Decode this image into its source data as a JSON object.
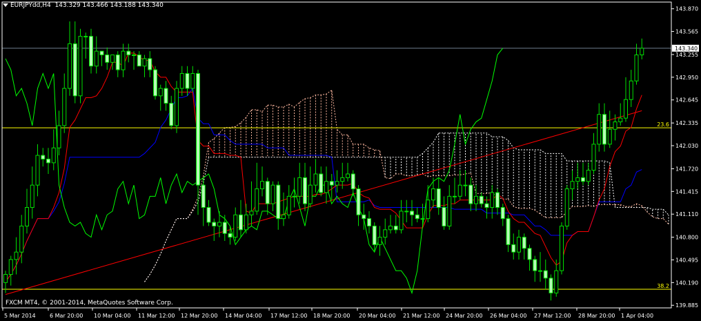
{
  "header": {
    "symbol_timeframe": "EURJPYdd,H4",
    "ohlc": "143.329 143.466 143.188 143.340"
  },
  "copyright": "FXCM MT4, © 2001-2014, MetaQuotes Software Corp.",
  "colors": {
    "background": "#000000",
    "axis": "#ffffff",
    "candle_body": "#b4ffb4",
    "candle_wick": "#00e000",
    "tenkan": "#ff0000",
    "kijun": "#0000ff",
    "chikou": "#00ff00",
    "cloud_a": "#ffb8a0",
    "cloud_b": "#ffffff",
    "fib": "#ffff00",
    "trendline": "#ff0000",
    "current_price_line": "#708090"
  },
  "chart_data": {
    "type": "candlestick",
    "y_ticks": [
      139.885,
      140.19,
      140.495,
      140.8,
      141.11,
      141.415,
      141.72,
      142.03,
      142.335,
      142.645,
      142.95,
      143.255,
      143.565,
      143.87
    ],
    "ylim": [
      139.85,
      143.96
    ],
    "x_ticks": [
      "5 Mar 2014",
      "6 Mar 20:00",
      "10 Mar 04:00",
      "11 Mar 12:00",
      "12 Mar 20:00",
      "14 Mar 04:00",
      "17 Mar 12:00",
      "18 Mar 20:00",
      "20 Mar 04:00",
      "21 Mar 12:00",
      "24 Mar 20:00",
      "26 Mar 04:00",
      "27 Mar 12:00",
      "28 Mar 20:00",
      "1 Apr 04:00"
    ],
    "current_price": {
      "label": "143.340",
      "value": 143.34
    },
    "fib_levels": [
      {
        "label": "23.6",
        "value": 142.27
      },
      {
        "label": "38.2",
        "value": 140.1
      }
    ],
    "trendline": {
      "start": {
        "bar": 0,
        "price": 140.03
      },
      "end": {
        "bar": 119,
        "price": 142.5
      }
    },
    "series": {
      "open": [
        140.19,
        140.3,
        140.5,
        140.6,
        140.95,
        141.2,
        141.5,
        141.9,
        141.85,
        141.8,
        142.0,
        142.3,
        142.8,
        143.4,
        142.7,
        143.5,
        143.5,
        143.1,
        143.3,
        143.25,
        143.15,
        143.25,
        143.05,
        143.3,
        143.25,
        143.25,
        143.1,
        143.2,
        143.05,
        142.7,
        142.8,
        142.6,
        142.3,
        142.8,
        143.0,
        142.8,
        143.0,
        141.5,
        141.2,
        141.0,
        140.95,
        141.0,
        140.85,
        140.8,
        141.1,
        140.9,
        141.1,
        141.15,
        141.45,
        141.55,
        141.25,
        141.5,
        141.05,
        141.1,
        141.35,
        141.35,
        141.6,
        141.25,
        141.5,
        141.65,
        141.4,
        141.55,
        141.5,
        141.55,
        141.6,
        141.65,
        141.45,
        141.1,
        141.05,
        140.95,
        140.7,
        140.8,
        140.9,
        140.95,
        140.9,
        141.15,
        141.15,
        141.1,
        141.05,
        141.05,
        141.3,
        141.45,
        141.2,
        140.95,
        141.35,
        141.35,
        141.5,
        141.5,
        141.25,
        141.35,
        141.25,
        141.2,
        141.4,
        141.2,
        141.05,
        140.7,
        140.6,
        140.8,
        140.65,
        140.5,
        140.35,
        140.35,
        140.25,
        140.05,
        140.35,
        140.95,
        141.45,
        141.55,
        141.6,
        141.55,
        141.7,
        142.05,
        142.45,
        142.05,
        142.25,
        142.35,
        142.4,
        142.65,
        142.9,
        143.25
      ],
      "high": [
        140.35,
        140.55,
        140.8,
        141.1,
        141.45,
        141.75,
        142.05,
        142.0,
        142.0,
        142.25,
        142.5,
        143.0,
        143.7,
        143.7,
        143.6,
        143.55,
        143.6,
        143.5,
        143.3,
        143.35,
        143.25,
        143.3,
        143.4,
        143.4,
        143.3,
        143.3,
        143.25,
        143.3,
        143.1,
        142.85,
        142.9,
        142.7,
        142.9,
        143.1,
        143.1,
        143.1,
        143.05,
        141.6,
        141.3,
        141.05,
        141.15,
        141.1,
        140.95,
        141.2,
        141.3,
        141.25,
        141.55,
        141.8,
        141.75,
        141.6,
        141.55,
        141.55,
        141.4,
        141.5,
        141.6,
        141.8,
        141.8,
        141.75,
        141.85,
        141.75,
        141.75,
        141.65,
        141.7,
        141.8,
        141.8,
        141.7,
        141.5,
        141.25,
        141.15,
        141.0,
        140.95,
        141.05,
        141.1,
        141.1,
        141.3,
        141.3,
        141.3,
        141.2,
        141.25,
        141.5,
        141.6,
        141.6,
        141.35,
        141.5,
        141.6,
        141.7,
        141.7,
        141.6,
        141.5,
        141.4,
        141.35,
        141.5,
        141.45,
        141.25,
        141.1,
        140.85,
        140.9,
        140.85,
        140.7,
        140.55,
        140.6,
        140.5,
        140.3,
        140.5,
        141.0,
        141.5,
        141.7,
        141.8,
        141.8,
        141.8,
        142.2,
        142.6,
        142.6,
        142.5,
        142.45,
        142.6,
        142.95,
        143.05,
        143.4,
        143.47
      ],
      "low": [
        140.05,
        140.15,
        140.3,
        140.45,
        140.85,
        141.05,
        141.35,
        141.75,
        141.65,
        141.7,
        141.9,
        142.2,
        142.7,
        142.6,
        142.6,
        143.2,
        143.0,
        143.0,
        143.1,
        143.05,
        143.05,
        142.95,
        142.95,
        143.15,
        143.05,
        143.1,
        142.95,
        142.95,
        142.65,
        142.5,
        142.5,
        142.25,
        142.2,
        142.7,
        142.7,
        142.75,
        141.1,
        140.95,
        140.95,
        140.75,
        140.8,
        140.75,
        140.7,
        140.75,
        140.8,
        140.85,
        140.95,
        141.1,
        141.35,
        141.1,
        141.15,
        140.9,
        140.95,
        141.05,
        141.2,
        141.25,
        141.15,
        141.2,
        141.4,
        141.35,
        141.25,
        141.3,
        141.4,
        141.45,
        141.55,
        141.35,
        140.95,
        140.9,
        140.85,
        140.6,
        140.55,
        140.7,
        140.85,
        140.85,
        140.85,
        141.0,
        140.95,
        141.0,
        140.95,
        141.0,
        141.2,
        141.1,
        140.9,
        140.9,
        141.25,
        141.3,
        141.35,
        141.15,
        141.15,
        141.2,
        141.05,
        141.05,
        141.1,
        140.95,
        140.6,
        140.5,
        140.5,
        140.5,
        140.35,
        140.2,
        140.2,
        140.1,
        139.95,
        140.0,
        140.3,
        140.9,
        141.3,
        141.45,
        141.5,
        141.5,
        141.65,
        141.95,
        141.95,
        142.0,
        142.1,
        142.3,
        142.35,
        142.55,
        142.85,
        143.19
      ],
      "close": [
        140.3,
        140.5,
        140.6,
        140.95,
        141.2,
        141.5,
        141.9,
        141.85,
        141.8,
        142.0,
        142.3,
        142.8,
        143.4,
        142.7,
        143.5,
        143.5,
        143.1,
        143.3,
        143.25,
        143.15,
        143.25,
        143.05,
        143.3,
        143.25,
        143.25,
        143.1,
        143.2,
        143.05,
        142.7,
        142.8,
        142.6,
        142.3,
        142.8,
        143.0,
        142.8,
        143.0,
        141.5,
        141.2,
        141.0,
        140.95,
        141.0,
        140.85,
        140.8,
        141.1,
        140.9,
        141.1,
        141.15,
        141.45,
        141.55,
        141.25,
        141.5,
        141.05,
        141.1,
        141.35,
        141.35,
        141.6,
        141.25,
        141.5,
        141.65,
        141.4,
        141.55,
        141.5,
        141.55,
        141.6,
        141.65,
        141.45,
        141.1,
        141.05,
        140.95,
        140.7,
        140.8,
        140.9,
        140.95,
        140.9,
        141.15,
        141.15,
        141.1,
        141.05,
        141.05,
        141.3,
        141.45,
        141.2,
        140.95,
        141.35,
        141.35,
        141.5,
        141.5,
        141.25,
        141.35,
        141.25,
        141.2,
        141.4,
        141.2,
        141.05,
        140.7,
        140.6,
        140.8,
        140.65,
        140.5,
        140.35,
        140.35,
        140.25,
        140.05,
        140.35,
        140.95,
        141.45,
        141.55,
        141.6,
        141.55,
        141.7,
        142.05,
        142.45,
        142.05,
        142.25,
        142.35,
        142.4,
        142.65,
        142.9,
        143.25,
        143.34
      ]
    }
  }
}
